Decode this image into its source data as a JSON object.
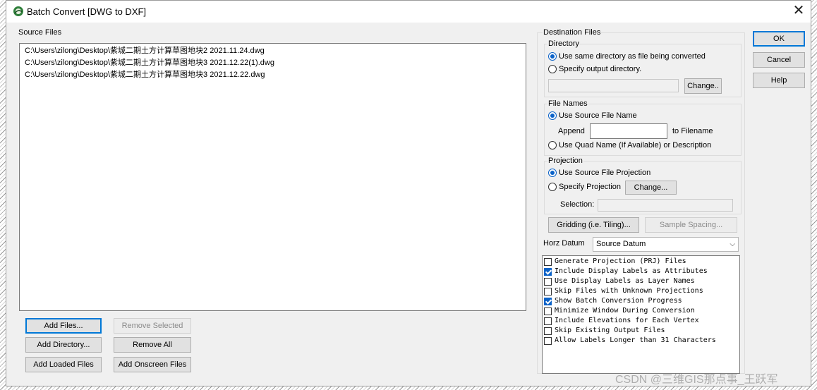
{
  "window": {
    "title": "Batch Convert [DWG to DXF]",
    "close_icon": "close-icon",
    "app_icon": "globe-leaf-icon"
  },
  "source": {
    "label": "Source Files",
    "files": [
      "C:\\Users\\zilong\\Desktop\\紫城二期土方计算草图地块2 2021.11.24.dwg",
      "C:\\Users\\zilong\\Desktop\\紫城二期土方计算草图地块3 2021.12.22(1).dwg",
      "C:\\Users\\zilong\\Desktop\\紫城二期土方计算草图地块3 2021.12.22.dwg"
    ],
    "buttons": {
      "add_files": "Add Files...",
      "remove_selected": "Remove Selected",
      "add_directory": "Add Directory...",
      "remove_all": "Remove All",
      "add_loaded": "Add Loaded Files",
      "add_onscreen": "Add Onscreen Files"
    }
  },
  "destination": {
    "label": "Destination Files",
    "directory": {
      "label": "Directory",
      "same_dir": "Use same directory as file being converted",
      "specify_dir": "Specify output directory.",
      "change": "Change.."
    },
    "file_names": {
      "label": "File Names",
      "use_source": "Use Source File Name",
      "append": "Append",
      "append_value": "",
      "to_filename": "to Filename",
      "quad_name": "Use Quad Name (If Available) or Description"
    },
    "projection": {
      "label": "Projection",
      "use_source": "Use Source File Projection",
      "specify": "Specify Projection",
      "change": "Change...",
      "selection": "Selection:"
    },
    "gridding": "Gridding (i.e. Tiling)...",
    "sample_spacing": "Sample Spacing...",
    "horz_datum_label": "Horz Datum",
    "horz_datum_value": "Source Datum",
    "options": [
      {
        "label": "Generate Projection (PRJ) Files",
        "checked": false
      },
      {
        "label": "Include Display Labels as Attributes",
        "checked": true
      },
      {
        "label": "Use Display Labels as Layer Names",
        "checked": false
      },
      {
        "label": "Skip Files with Unknown Projections",
        "checked": false
      },
      {
        "label": "Show Batch Conversion Progress",
        "checked": true
      },
      {
        "label": "Minimize Window During Conversion",
        "checked": false
      },
      {
        "label": "Include Elevations for Each Vertex",
        "checked": false
      },
      {
        "label": "Skip Existing Output Files",
        "checked": false
      },
      {
        "label": "Allow Labels Longer than 31 Characters",
        "checked": false
      }
    ]
  },
  "actions": {
    "ok": "OK",
    "cancel": "Cancel",
    "help": "Help"
  },
  "watermark": "CSDN @三维GIS那点事_王跃军",
  "colors": {
    "accent": "#0a62c8",
    "dialog_bg": "#f0f0f0"
  }
}
